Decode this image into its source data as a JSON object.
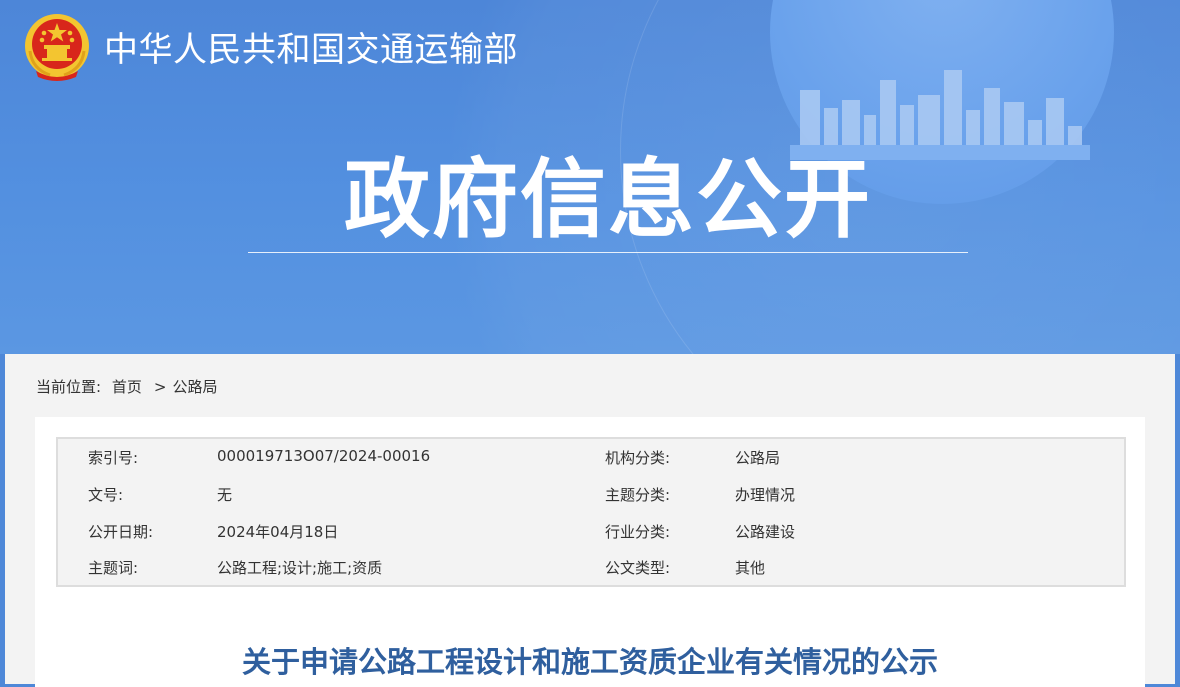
{
  "header": {
    "ministry_name": "中华人民共和国交通运输部",
    "section_title": "政府信息公开"
  },
  "breadcrumb": {
    "prefix": "当前位置:",
    "home": "首页",
    "separator": ">",
    "current": "公路局"
  },
  "meta": {
    "rows": [
      {
        "k1": "索引号:",
        "v1": "000019713O07/2024-00016",
        "k2": "机构分类:",
        "v2": "公路局"
      },
      {
        "k1": "文号:",
        "v1": "无",
        "k2": "主题分类:",
        "v2": "办理情况"
      },
      {
        "k1": "公开日期:",
        "v1": "2024年04月18日",
        "k2": "行业分类:",
        "v2": "公路建设"
      },
      {
        "k1": "主题词:",
        "v1": "公路工程;设计;施工;资质",
        "k2": "公文类型:",
        "v2": "其他"
      }
    ]
  },
  "document": {
    "title": "关于申请公路工程设计和施工资质企业有关情况的公示"
  },
  "colors": {
    "banner_blue": "#4d86d8",
    "title_blue": "#2f5f9e",
    "emblem_red": "#d8261b",
    "emblem_gold": "#f3c530"
  },
  "icons": {
    "emblem": "national-emblem-icon",
    "skyline": "city-skyline-icon"
  }
}
